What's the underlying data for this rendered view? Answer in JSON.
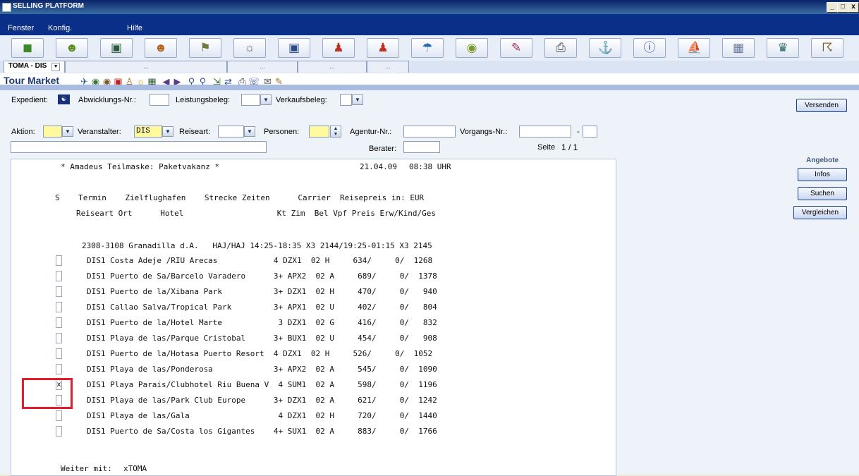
{
  "window": {
    "title": "SELLING PLATFORM",
    "controls": [
      "_",
      "□",
      "x"
    ]
  },
  "menu": [
    "Fenster",
    "Konfig.",
    "Hilfe"
  ],
  "toolbar_icons": [
    "cube-icon",
    "smiley-icon",
    "screen-icon",
    "person-icon",
    "map-icon",
    "sun-icon",
    "car-icon",
    "hotel-staff-icon",
    "hotel-staff-add-icon",
    "umbrella-icon",
    "money-icon",
    "notepad-icon",
    "print-icon",
    "ship-icon",
    "info-icon",
    "cruise-icon",
    "window-icon",
    "bell-icon",
    "scroll-icon"
  ],
  "tabs": [
    {
      "label": "TOMA - DIS",
      "active": true
    },
    {
      "label": "...",
      "active": false
    },
    {
      "label": "...",
      "active": false
    },
    {
      "label": "...",
      "active": false
    },
    {
      "label": "...",
      "active": false
    }
  ],
  "header": {
    "title": "Tour Market"
  },
  "form": {
    "expedient_label": "Expedient:",
    "abwicklung_label": "Abwicklungs-Nr.:",
    "leistungsbeleg_label": "Leistungsbeleg:",
    "verkaufsbeleg_label": "Verkaufsbeleg:",
    "aktion_label": "Aktion:",
    "veranstalter_label": "Veranstalter:",
    "veranstalter_value": "DIS",
    "reiseart_label": "Reiseart:",
    "personen_label": "Personen:",
    "agentur_label": "Agentur-Nr.:",
    "vorgang_label": "Vorgangs-Nr.:",
    "dash": "-",
    "berater_label": "Berater:",
    "seite_label": "Seite",
    "seite_value": "1 / 1"
  },
  "buttons": {
    "versenden": "Versenden",
    "angebote_label": "Angebote",
    "infos": "Infos",
    "suchen": "Suchen",
    "vergleichen": "Vergleichen"
  },
  "terminal": {
    "header_line": "* Amadeus Teilmaske: Paketvakanz *",
    "date": "21.04.09",
    "time": "08:38 UHR",
    "col_line1": "S    Termin    Zielflughafen    Strecke Zeiten      Carrier  Reisepreis in: EUR",
    "col_line2": "Reiseart Ort      Hotel                    Kt Zim  Bel Vpf Preis Erw/Kind/Ges",
    "trip_line": "2308-3108 Granadilla d.A.   HAJ/HAJ 14:25-18:35 X3 2144/19:25-01:15 X3 2145",
    "rows": [
      {
        "sel": "",
        "text": "DIS1 Costa Adeje /RIU Arecas            4 DZX1  02 H     634/     0/  1268"
      },
      {
        "sel": "",
        "text": "DIS1 Puerto de Sa/Barcelo Varadero      3+ APX2  02 A     689/     0/  1378"
      },
      {
        "sel": "",
        "text": "DIS1 Puerto de la/Xibana Park           3+ DZX1  02 H     470/     0/   940"
      },
      {
        "sel": "",
        "text": "DIS1 Callao Salva/Tropical Park         3+ APX1  02 U     402/     0/   804"
      },
      {
        "sel": "",
        "text": "DIS1 Puerto de la/Hotel Marte            3 DZX1  02 G     416/     0/   832"
      },
      {
        "sel": "",
        "text": "DIS1 Playa de las/Parque Cristobal      3+ BUX1  02 U     454/     0/   908"
      },
      {
        "sel": "",
        "text": "DIS1 Puerto de la/Hotasa Puerto Resort  4 DZX1  02 H     526/     0/  1052"
      },
      {
        "sel": "",
        "text": "DIS1 Playa de las/Ponderosa             3+ APX2  02 A     545/     0/  1090"
      },
      {
        "sel": "x",
        "text": "DIS1 Playa Parais/Clubhotel Riu Buena V  4 SUM1  02 A     598/     0/  1196"
      },
      {
        "sel": "",
        "text": "DIS1 Playa de las/Park Club Europe      3+ DZX1  02 A     621/     0/  1242"
      },
      {
        "sel": "",
        "text": "DIS1 Playa de las/Gala                   4 DZX1  02 H     720/     0/  1440"
      },
      {
        "sel": "",
        "text": "DIS1 Puerto de Sa/Costa los Gigantes    4+ SUX1  02 A     883/     0/  1766"
      }
    ],
    "weiter_label": "Weiter mit:",
    "weiter_value": "xTOMA"
  },
  "colors": {
    "titlebar": "#0a246a",
    "menubar": "#0a2f88",
    "highlight": "#e8192c",
    "field_yellow": "#fffaa0"
  }
}
